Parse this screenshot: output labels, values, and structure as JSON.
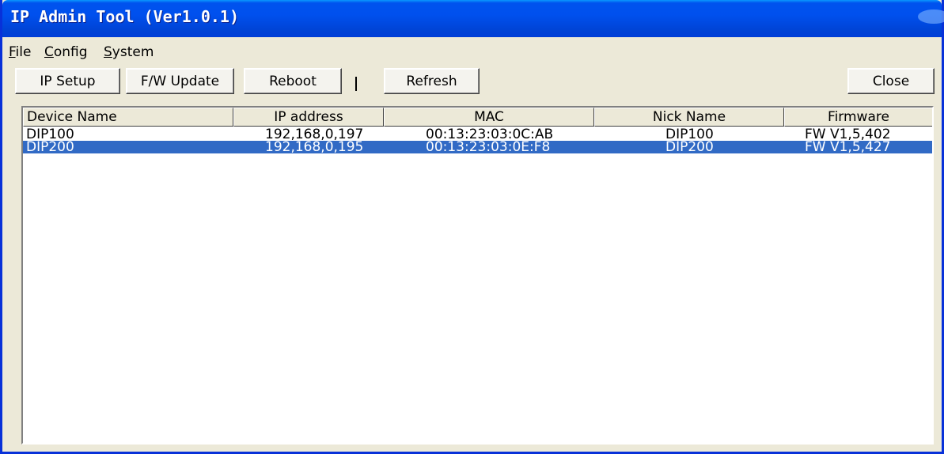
{
  "window": {
    "title": "IP Admin Tool (Ver1.0.1)"
  },
  "menu": {
    "items": [
      {
        "label": "File"
      },
      {
        "label": "Config"
      },
      {
        "label": "System"
      }
    ]
  },
  "toolbar": {
    "ip_setup": "IP Setup",
    "fw_update": "F/W Update",
    "reboot": "Reboot",
    "refresh": "Refresh",
    "close": "Close"
  },
  "table": {
    "columns": [
      "Device Name",
      "IP address",
      "MAC",
      "Nick Name",
      "Firmware"
    ],
    "rows": [
      [
        "DIP100",
        "192,168,0,197",
        "00:13:23:03:0C:AB",
        "DIP100",
        "FW V1,5,402"
      ],
      [
        "DIP200",
        "192,168,0,195",
        "00:13:23:03:0E:F8",
        "DIP200",
        "FW V1,5,427"
      ]
    ],
    "selected_row": 1
  },
  "colors": {
    "title_bar": "#0054e3",
    "selection": "#316ac5",
    "face": "#ece9d8"
  }
}
